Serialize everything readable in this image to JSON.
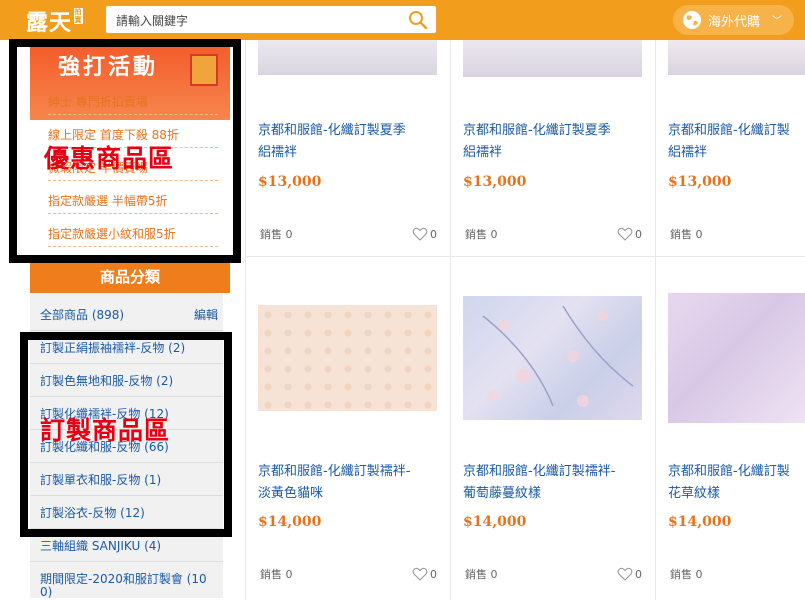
{
  "header": {
    "logo": "露天",
    "logo_badge": "拍賣",
    "search_placeholder": "請輸入關鍵字",
    "overseas_label": "海外代購",
    "chevron": "﹀",
    "colors": {
      "bar": "#f29e1c"
    }
  },
  "promo": {
    "title": "強打活動",
    "items": [
      "紳士 專門折扣賣場",
      "線上限定 首度下殺 88折",
      "微瑕限定 半價賣場",
      "指定款嚴選 半幅帶5折",
      "指定款嚴選小紋和服5折"
    ]
  },
  "categories": {
    "header": "商品分類",
    "all": "全部商品 (898)",
    "edit": "編輯",
    "items": [
      "訂製正絹振袖襦袢-反物 (2)",
      "訂製色無地和服-反物 (2)",
      "訂製化纖襦袢-反物 (12)",
      "訂製化纖和服-反物 (66)",
      "訂製單衣和服-反物 (1)",
      "訂製浴衣-反物 (12)",
      "三軸組織 SANJIKU (4)",
      "期間限定-2020和服訂製會 (10",
      "0)"
    ]
  },
  "annotations": {
    "promo_label": "優惠商品區",
    "custom_label": "訂製商品區"
  },
  "products": [
    {
      "title1": "京都和服館-化纖訂製夏季",
      "title2": "絽襦袢",
      "price": "$13,000",
      "sold": "銷售  0",
      "likes": "0"
    },
    {
      "title1": "京都和服館-化纖訂製夏季",
      "title2": "絽襦袢",
      "price": "$13,000",
      "sold": "銷售  0",
      "likes": "0"
    },
    {
      "title1": "京都和服館-化纖訂製",
      "title2": "絽襦袢",
      "price": "$13,000",
      "sold": "銷售  0",
      "likes": ""
    },
    {
      "title1": "京都和服館-化纖訂製襦袢-",
      "title2": "淡黃色貓咪",
      "price": "$14,000",
      "sold": "銷售  0",
      "likes": "0"
    },
    {
      "title1": "京都和服館-化纖訂製襦袢-",
      "title2": "葡萄藤蔓紋樣",
      "price": "$14,000",
      "sold": "銷售  0",
      "likes": "0"
    },
    {
      "title1": "京都和服館-化纖訂製",
      "title2": "花草紋樣",
      "price": "$14,000",
      "sold": "銷售  0",
      "likes": ""
    }
  ]
}
